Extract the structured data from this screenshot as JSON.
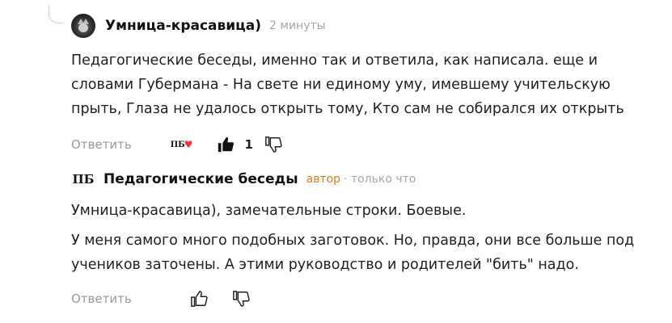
{
  "comment1": {
    "author": "Умница-красавица)",
    "time": "2 минуты",
    "lines": [
      "Педагогические беседы, именно так и ответила, как написала. еще и",
      "словами Губермана - На свете ни единому уму, имевшему учительскую",
      "прыть, Глаза не удалось открыть тому, Кто сам не собирался их открыть"
    ],
    "reply_label": "Ответить",
    "author_liked_badge": "ПБ",
    "likes_count": "1",
    "liked_by_user": true
  },
  "comment2": {
    "author_avatar_text": "ПБ",
    "author": "Педагогические беседы",
    "author_tag": "автор",
    "time": "· только что",
    "paragraphs": [
      "Умница-красавица), замечательные строки. Боевые.",
      "У меня самого много подобных заготовок. Но, правда, они все больше под учеников заточены. А этими руководство и родителей \"бить\" надо."
    ],
    "reply_label": "Ответить"
  },
  "colors": {
    "author_tag": "#d97a20",
    "muted_text": "#9a9a9a",
    "heart": "#e8333a"
  },
  "icons": [
    "cat-avatar-icon",
    "pb-avatar-icon",
    "thumb-up-icon",
    "thumb-down-icon",
    "heart-icon"
  ]
}
